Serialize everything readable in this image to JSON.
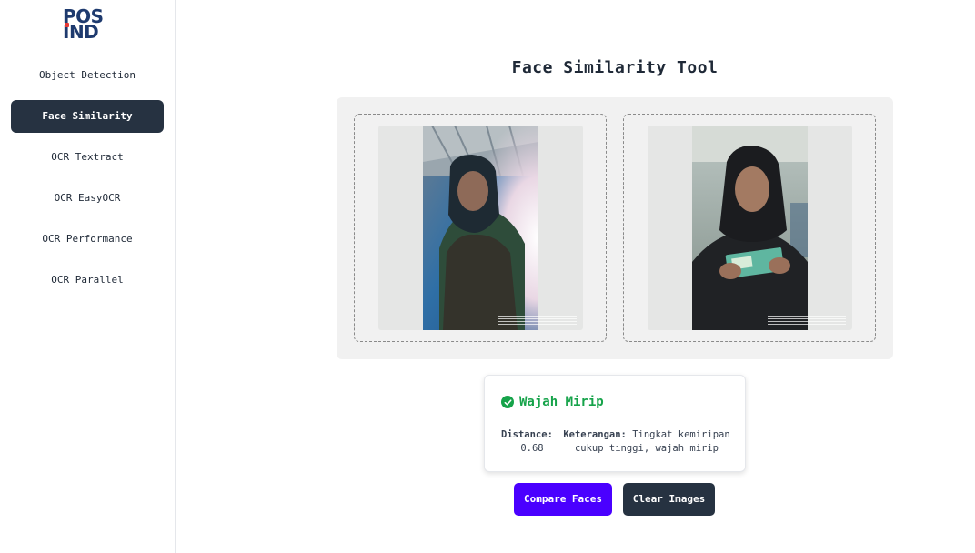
{
  "brand": {
    "line1": "POS",
    "line2": "IND",
    "colors": {
      "navy": "#1e3a6e",
      "red": "#e53935"
    }
  },
  "sidebar": {
    "items": [
      {
        "label": "Object Detection",
        "active": false
      },
      {
        "label": "Face Similarity",
        "active": true
      },
      {
        "label": "OCR Textract",
        "active": false
      },
      {
        "label": "OCR EasyOCR",
        "active": false
      },
      {
        "label": "OCR Performance",
        "active": false
      },
      {
        "label": "OCR Parallel",
        "active": false
      }
    ]
  },
  "main": {
    "title": "Face Similarity Tool",
    "images": [
      {
        "name": "left-face-image"
      },
      {
        "name": "right-face-image"
      }
    ]
  },
  "result": {
    "status": "Wajah Mirip",
    "status_icon": "check-circle-icon",
    "status_color": "#16a34a",
    "distance_label": "Distance:",
    "distance_value": "0.68",
    "keterangan_label": "Keterangan:",
    "keterangan_text_1": "Tingkat kemiripan",
    "keterangan_text_2": "cukup tinggi, wajah mirip"
  },
  "actions": {
    "compare_label": "Compare Faces",
    "clear_label": "Clear Images",
    "compare_color": "#4a00ff",
    "clear_color": "#263241"
  }
}
